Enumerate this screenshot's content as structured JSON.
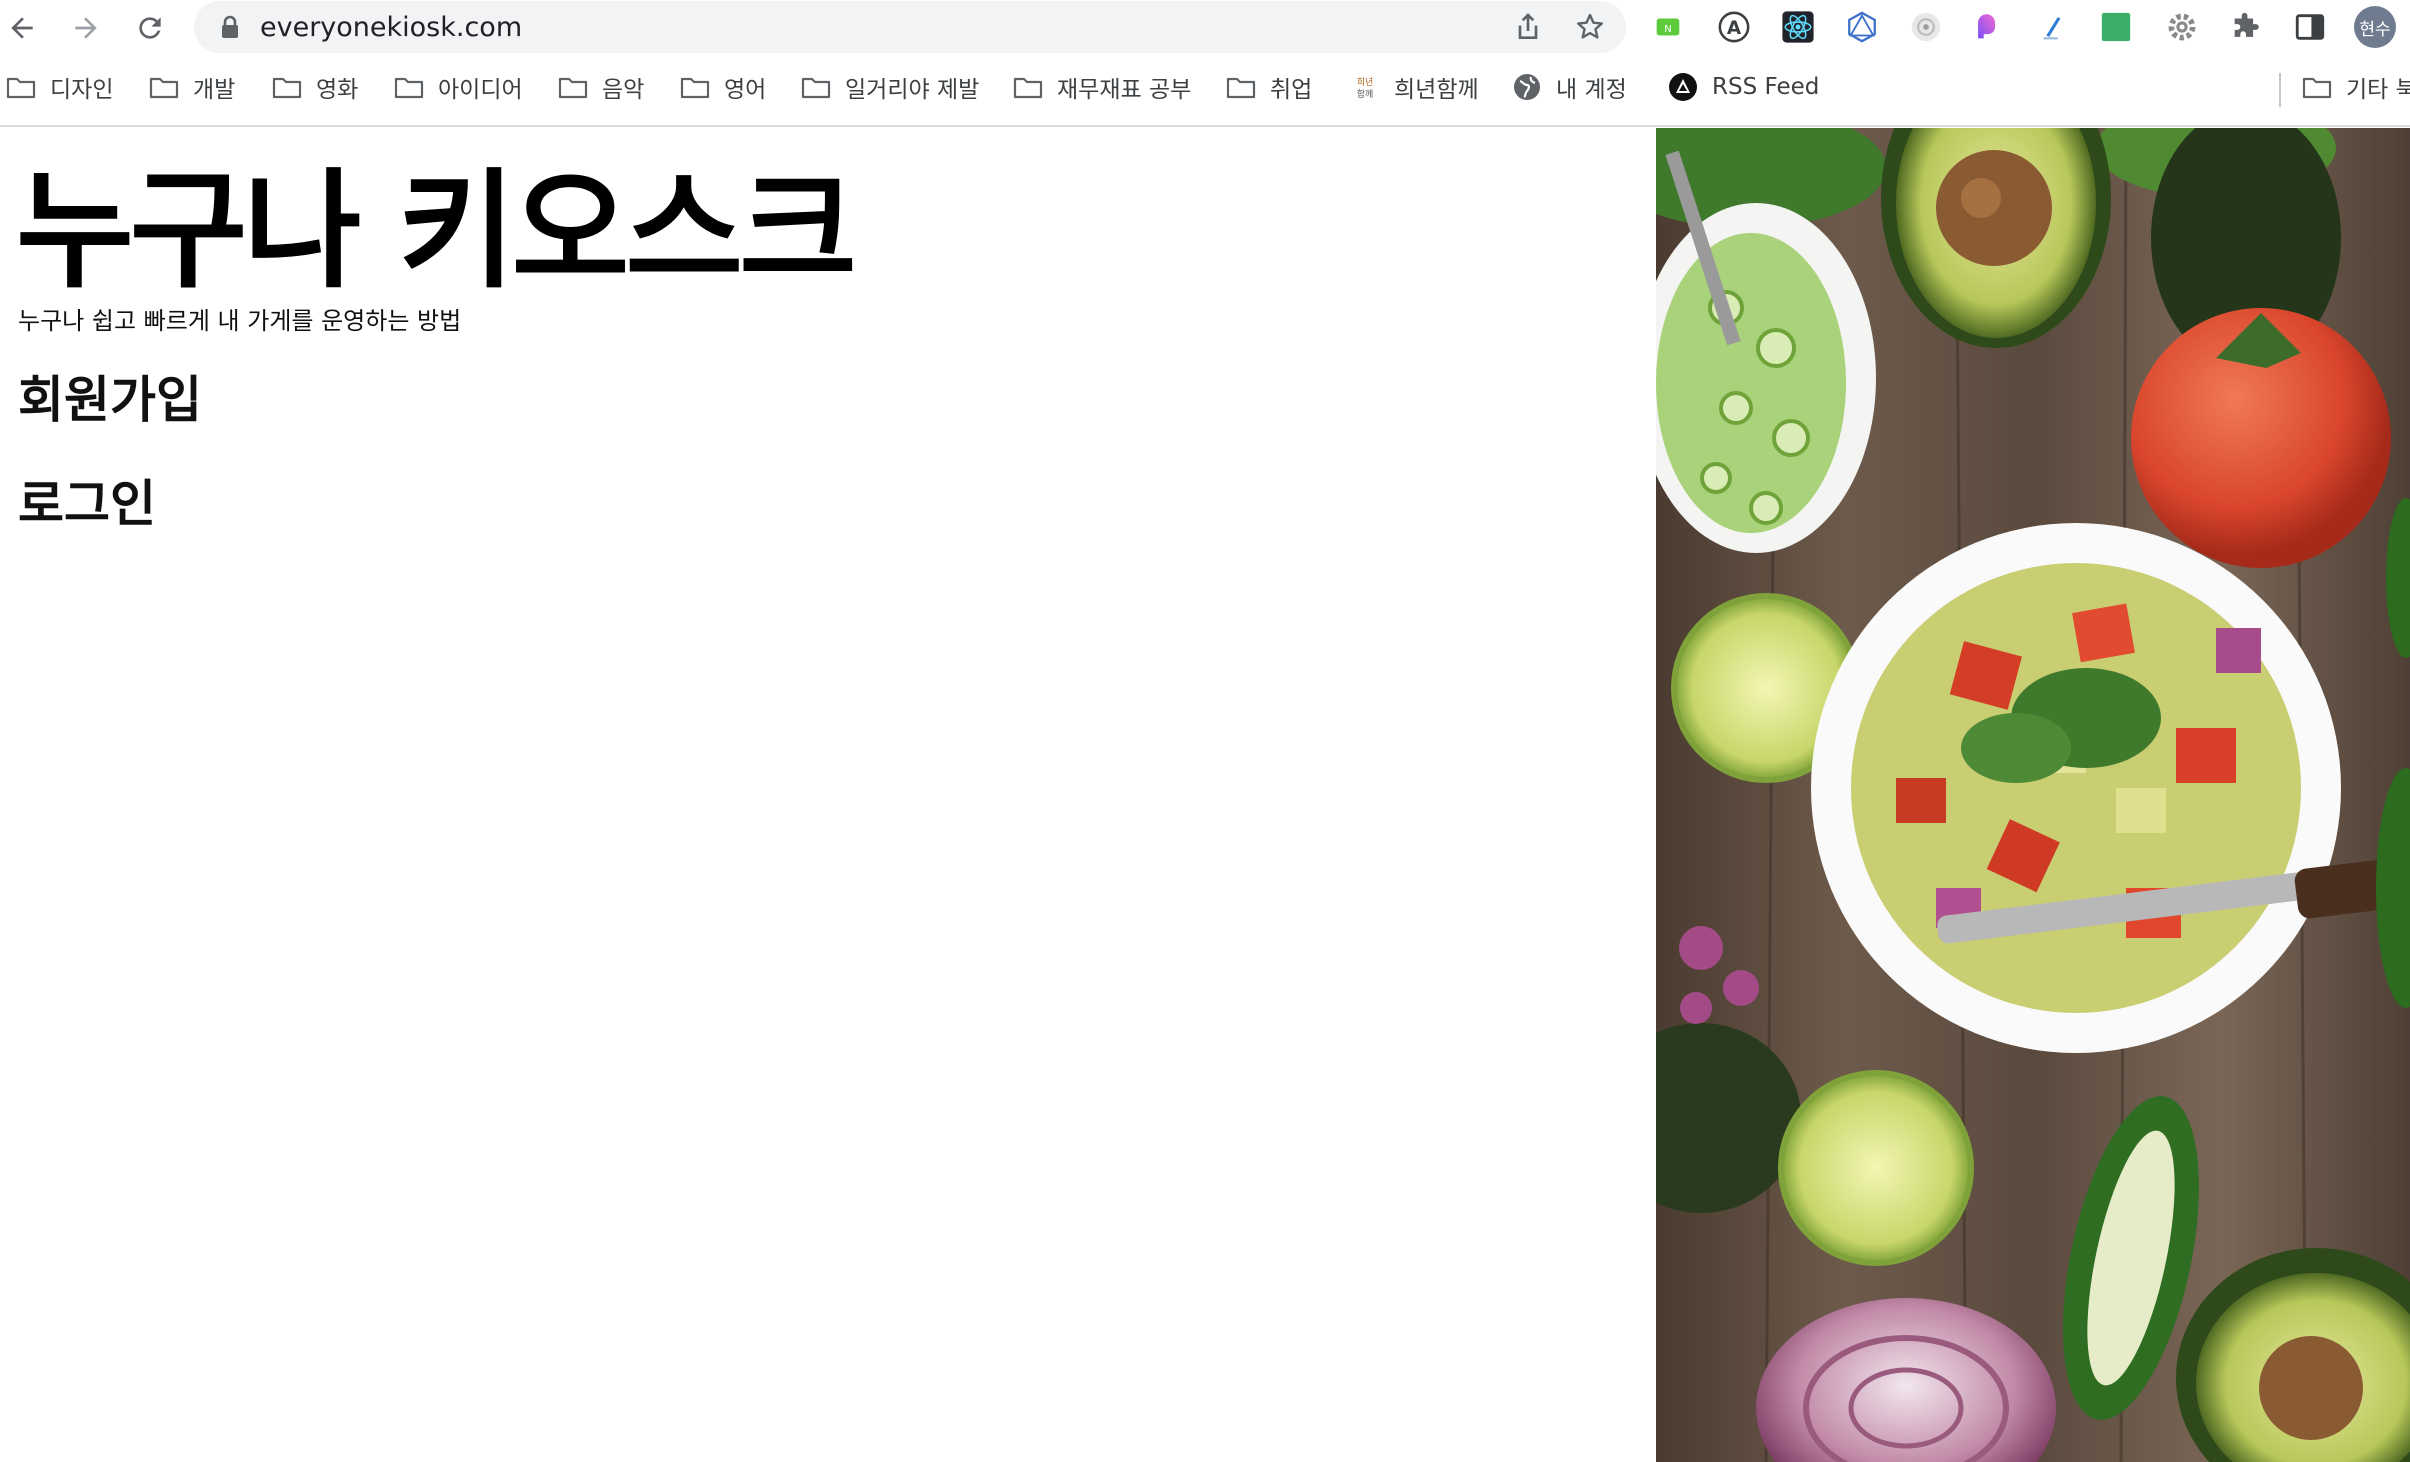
{
  "browser": {
    "url": "everyonekiosk.com",
    "profile_initials": "현수",
    "toolbar_icons": [
      "back-icon",
      "forward-icon",
      "reload-icon",
      "lock-icon",
      "share-icon",
      "star-icon"
    ],
    "extension_icons": [
      "naver-extension-icon",
      "a-circle-extension-icon",
      "react-devtools-icon",
      "graphql-extension-icon",
      "camera-extension-icon",
      "gradient-extension-icon",
      "pen-extension-icon",
      "green-square-extension-icon",
      "gear-extension-icon",
      "puzzle-icon",
      "side-panel-icon"
    ]
  },
  "bookmarks": [
    {
      "label": "디자인",
      "icon": "folder-icon"
    },
    {
      "label": "개발",
      "icon": "folder-icon"
    },
    {
      "label": "영화",
      "icon": "folder-icon"
    },
    {
      "label": "아이디어",
      "icon": "folder-icon"
    },
    {
      "label": "음악",
      "icon": "folder-icon"
    },
    {
      "label": "영어",
      "icon": "folder-icon"
    },
    {
      "label": "일거리야 제발",
      "icon": "folder-icon"
    },
    {
      "label": "재무재표 공부",
      "icon": "folder-icon"
    },
    {
      "label": "취업",
      "icon": "folder-icon"
    },
    {
      "label": "희년함께",
      "icon": "site-favicon",
      "favicon_text": "희년함께"
    },
    {
      "label": "내 계정",
      "icon": "globe-icon"
    },
    {
      "label": "RSS Feed",
      "icon": "rss-icon"
    }
  ],
  "other_bookmarks": "기타 북",
  "page": {
    "title": "누구나 키오스크",
    "tagline": "누구나 쉽고 빠르게 내 가게를 운영하는 방법",
    "signup": "회원가입",
    "login": "로그인"
  },
  "hero_image": {
    "subject": "salad-bowl-with-vegetables-photo"
  }
}
